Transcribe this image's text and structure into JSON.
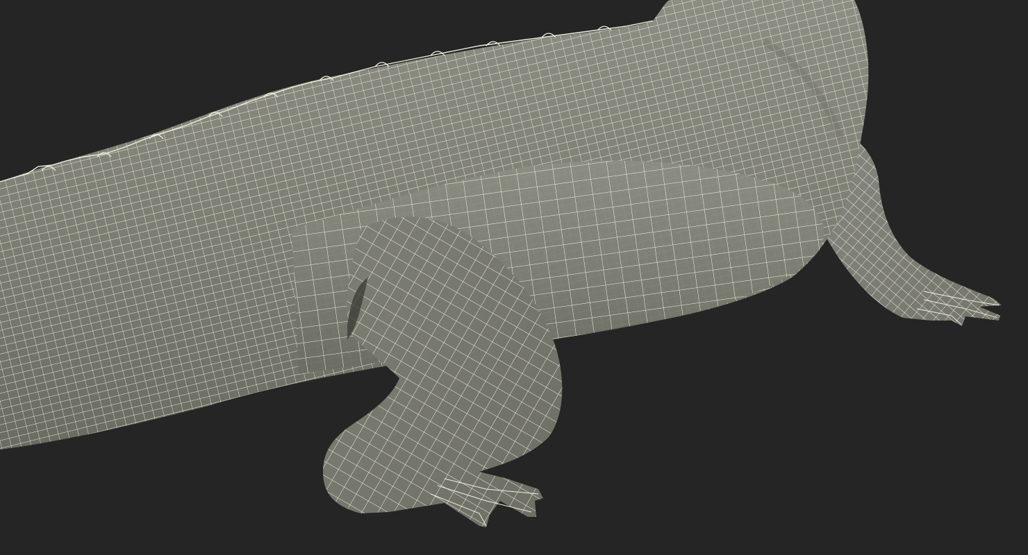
{
  "scene": {
    "subject": "alligator-wireframe-model",
    "colors": {
      "background": "#252525",
      "surface_light": "#8a8b80",
      "surface_mid": "#7a7b70",
      "surface_dark": "#5c5d54",
      "wire": "#f4f2e2"
    }
  }
}
